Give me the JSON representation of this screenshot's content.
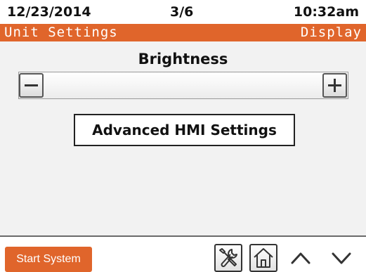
{
  "status_bar": {
    "date": "12/23/2014",
    "page": "3/6",
    "time": "10:32am"
  },
  "title_bar": {
    "title": "Unit Settings",
    "mode": "Display"
  },
  "content": {
    "brightness_label": "Brightness",
    "advanced_button_label": "Advanced HMI Settings"
  },
  "bottom_bar": {
    "start_system_label": "Start System"
  },
  "icons": {
    "brightness_decrease": "minus-icon",
    "brightness_increase": "plus-icon",
    "settings": "tools-icon",
    "home": "home-icon",
    "scroll_up": "chevron-up-icon",
    "scroll_down": "chevron-down-icon"
  },
  "colors": {
    "accent": "#e0652b",
    "background": "#f2f2f2",
    "text": "#111111"
  }
}
